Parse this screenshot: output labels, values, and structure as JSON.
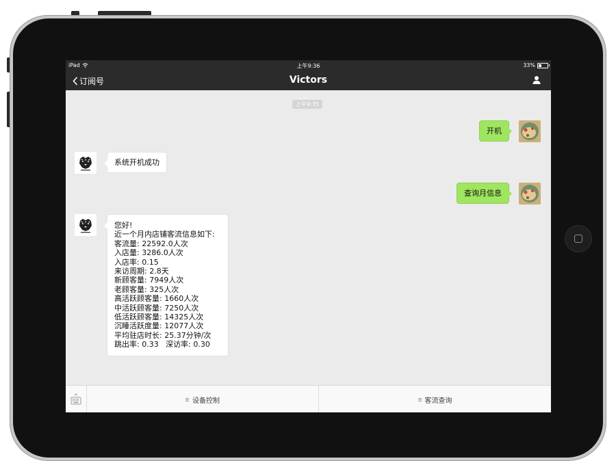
{
  "status_bar": {
    "device": "iPad",
    "time": "上午9:36",
    "battery": "33%"
  },
  "nav": {
    "back_label": "订阅号",
    "title": "Victors"
  },
  "chat": {
    "timestamp": "上午9:35",
    "messages": [
      {
        "sender": "user",
        "text": "开机"
      },
      {
        "sender": "bot",
        "text": "系统开机成功"
      },
      {
        "sender": "user",
        "text": "查询月信息"
      },
      {
        "sender": "bot",
        "lines": [
          "您好!",
          "近一个月内店铺客流信息如下:",
          "客流量: 22592.0人次",
          "入店量: 3286.0人次",
          "入店率: 0.15",
          "来访周期: 2.8天",
          "新顾客量: 7949人次",
          "老顾客量: 325人次",
          "高活跃顾客量: 1660人次",
          "中活跃顾客量: 7250人次",
          "低活跃顾客量: 14325人次",
          "沉睡活跃度量: 12077人次",
          "平均驻店时长: 25.37分钟/次",
          "跳出率: 0.33   深访率: 0.30"
        ]
      }
    ]
  },
  "menu": {
    "items": [
      "设备控制",
      "客流查询"
    ]
  },
  "colors": {
    "bar_bg": "#2b2b2b",
    "chat_bg": "#ebebeb",
    "user_bubble": "#9fe55f",
    "bot_bubble": "#ffffff"
  },
  "icons": {
    "back": "chevron-left-icon",
    "profile": "person-icon",
    "wifi": "wifi-icon",
    "battery": "battery-icon",
    "keyboard": "keyboard-icon",
    "menu": "menu-lines-icon"
  }
}
